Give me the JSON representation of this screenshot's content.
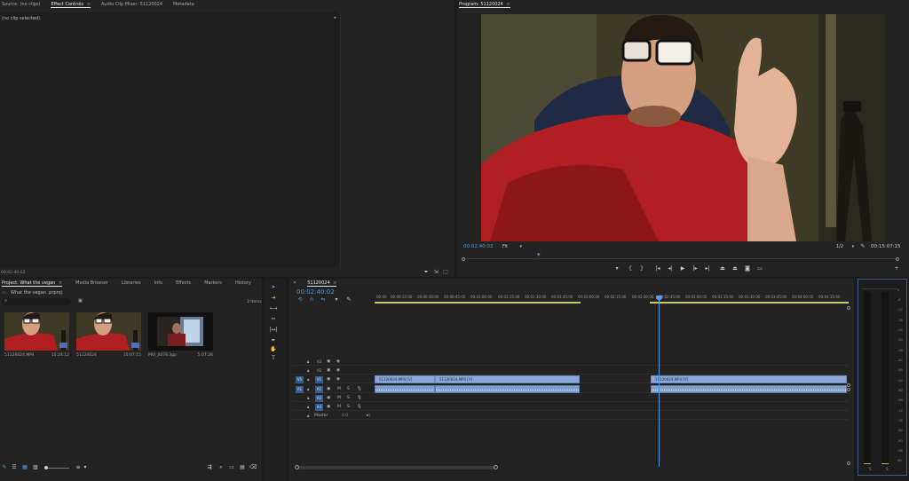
{
  "source_panel": {
    "tabs": [
      "Source: (no clips)",
      "Effect Controls",
      "Audio Clip Mixer: 51120024",
      "Metadata"
    ],
    "menu_icon": "hamburger-icon",
    "no_clip_text": "(no clip selected)",
    "timecode": "00:02:40:02"
  },
  "program_panel": {
    "title": "Program: 51120024",
    "timecode_current": "00:02:40:02",
    "fit": "Fit",
    "resolution": "1/2",
    "timecode_total": "00:15:07:15"
  },
  "project_panel": {
    "tabs": [
      "Project: What the vegan",
      "Media Browser",
      "Libraries",
      "Info",
      "Effects",
      "Markers",
      "History"
    ],
    "project_file": "What the vegan .prproj",
    "items_count": "3 Items",
    "search_placeholder": "",
    "items": [
      {
        "name": "51120024.MP4",
        "duration": "15:24:12"
      },
      {
        "name": "51120024",
        "duration": "15:07:15"
      },
      {
        "name": "MVI_0078.3gp",
        "duration": "5:07:26"
      }
    ]
  },
  "timeline": {
    "sequence_tab": "51120024",
    "timecode": "00:02:40:02",
    "ruler": [
      "00:00",
      "00:00:15:00",
      "00:00:30:00",
      "00:00:45:00",
      "00:01:00:00",
      "00:01:15:00",
      "00:01:30:00",
      "00:01:45:00",
      "00:02:00:00",
      "00:02:15:00",
      "00:02:30:00",
      "00:02:45:00",
      "00:03:00:00",
      "00:03:15:00",
      "00:03:30:00",
      "00:03:45:00",
      "00:04:00:00",
      "00:04:15:00"
    ],
    "video_tracks": [
      "V3",
      "V2",
      "V1"
    ],
    "audio_tracks": [
      "A1",
      "A2",
      "A3"
    ],
    "track_target_v": "V1",
    "track_target_a": "A1",
    "master_label": "Master",
    "master_value": "0.0",
    "clips": [
      {
        "label": "51120024.MP4 [V]"
      },
      {
        "label": "51120024.MP4 [V]"
      },
      {
        "label": "51120024.MP4 [V]"
      }
    ]
  },
  "meter": {
    "scale": [
      "0",
      "-6",
      "-12",
      "-18",
      "-24",
      "-30",
      "-36",
      "-42",
      "-48",
      "-54",
      "-60",
      "-66",
      "-72",
      "-78",
      "-84",
      "-90",
      "-96",
      "dB"
    ],
    "channels": [
      "S",
      "S"
    ]
  },
  "colors": {
    "accent": "#4f9be8",
    "clip_video": "#8aa7d6",
    "clip_audio": "#7f9dcc",
    "panel_bg": "#232323",
    "work_area": "#c9c96a"
  }
}
